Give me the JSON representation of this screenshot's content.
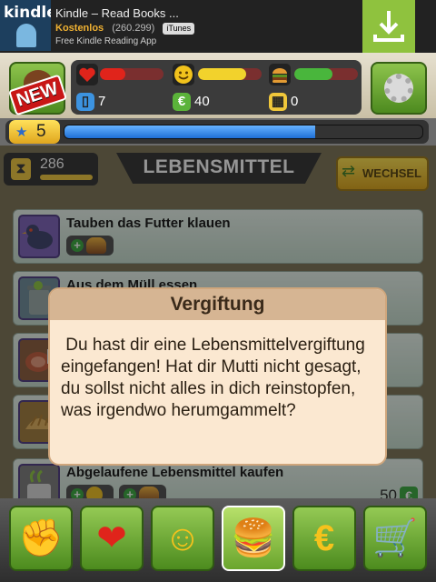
{
  "ad": {
    "logo_text": "kindle",
    "title": "Kindle – Read Books ...",
    "price_label": "Kostenlos",
    "rating_count": "(260.299)",
    "store_badge": "iTunes",
    "description": "Free Kindle Reading App",
    "download_icon": "download-icon"
  },
  "header": {
    "new_badge": "NEW",
    "stats": [
      {
        "icon": "heart-icon",
        "level": 0.4,
        "color": "#e0241b"
      },
      {
        "icon": "smiley-icon",
        "level": 0.75,
        "color": "#f2d22c"
      },
      {
        "icon": "burger-icon",
        "level": 0.6,
        "color": "#49b63c"
      }
    ],
    "resources": {
      "phone": "7",
      "money": "40",
      "item": "0"
    },
    "settings_icon": "gear-icon"
  },
  "level": {
    "value": "5",
    "progress": 0.7
  },
  "section": {
    "timer_value": "286",
    "title": "LEBENSMITTEL",
    "change_label": "WECHSEL"
  },
  "items": [
    {
      "title": "Tauben das Futter klauen",
      "price": ""
    },
    {
      "title": "Aus dem Müll essen",
      "price": ""
    },
    {
      "title": "",
      "price": ""
    },
    {
      "title": "",
      "price": ""
    },
    {
      "title": "Abgelaufene Lebensmittel kaufen",
      "price": "50"
    }
  ],
  "dialog": {
    "title": "Vergiftung",
    "message": " Du hast dir eine Lebensmittelvergiftung eingefangen! Hat dir Mutti nicht gesagt, du sollst nicht alles in dich reinstopfen, was irgendwo herumgammelt?"
  },
  "tabs": [
    {
      "icon": "fist-icon",
      "glyph": "✊",
      "active": false
    },
    {
      "icon": "heart-icon",
      "glyph": "❤",
      "active": false
    },
    {
      "icon": "smiley-icon",
      "glyph": "☺",
      "active": false
    },
    {
      "icon": "burger-icon",
      "glyph": "🍔",
      "active": true
    },
    {
      "icon": "euro-icon",
      "glyph": "€",
      "active": false
    },
    {
      "icon": "cart-icon",
      "glyph": "🛒",
      "active": false
    }
  ],
  "colors": {
    "accent_green": "#5d9f2a",
    "xp_blue": "#2f86e8",
    "dialog_bg": "#fbe8d1"
  }
}
